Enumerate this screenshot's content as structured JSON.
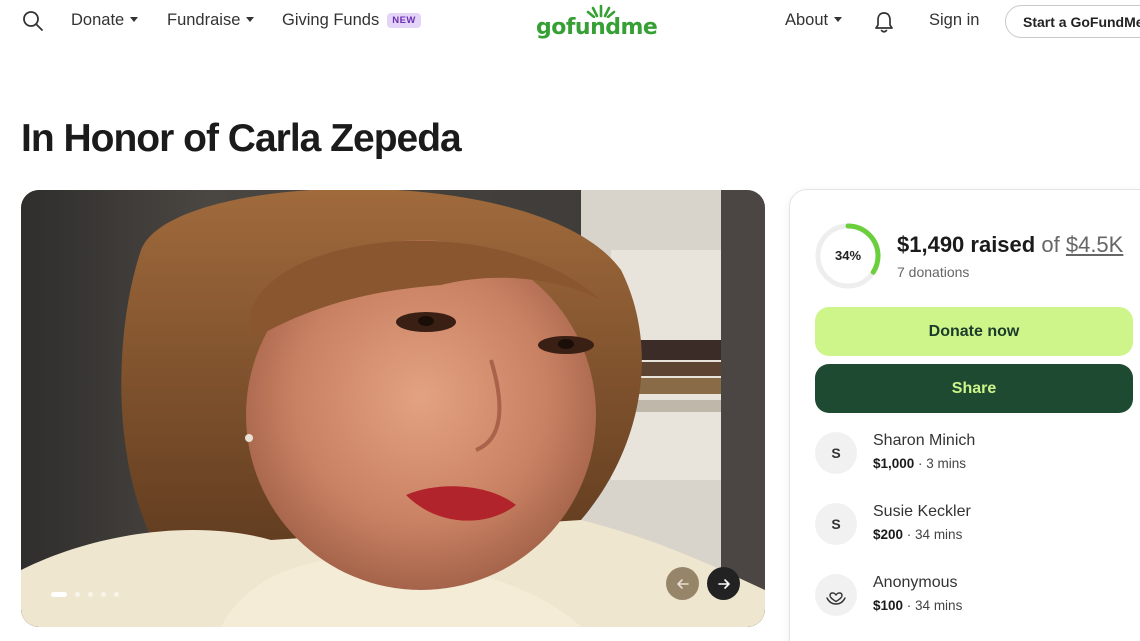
{
  "nav": {
    "donate": "Donate",
    "fundraise": "Fundraise",
    "giving_funds": "Giving Funds",
    "new_badge": "NEW",
    "logo": "gofundme",
    "about": "About",
    "sign_in": "Sign in",
    "start": "Start a GoFundMe"
  },
  "campaign": {
    "title": "In Honor of Carla Zepeda",
    "percent": 34,
    "percent_label": "34%",
    "raised": "$1,490 raised",
    "of": "of",
    "goal": "$4.5K",
    "donations": "7 donations",
    "donate_label": "Donate now",
    "share_label": "Share",
    "slide_count": 5,
    "active_slide": 0
  },
  "donors": [
    {
      "initial": "S",
      "name": "Sharon Minich",
      "amount": "$1,000",
      "time": "3 mins"
    },
    {
      "initial": "S",
      "name": "Susie Keckler",
      "amount": "$200",
      "time": "34 mins"
    },
    {
      "initial": "",
      "name": "Anonymous",
      "amount": "$100",
      "time": "34 mins",
      "icon": "heart-hand-icon"
    }
  ],
  "colors": {
    "brand": "#36a035",
    "donate_bg": "#cdf58a",
    "share_bg": "#1f4a32",
    "progress": "#6bcf3d",
    "badge_bg": "#e4d4f8"
  }
}
